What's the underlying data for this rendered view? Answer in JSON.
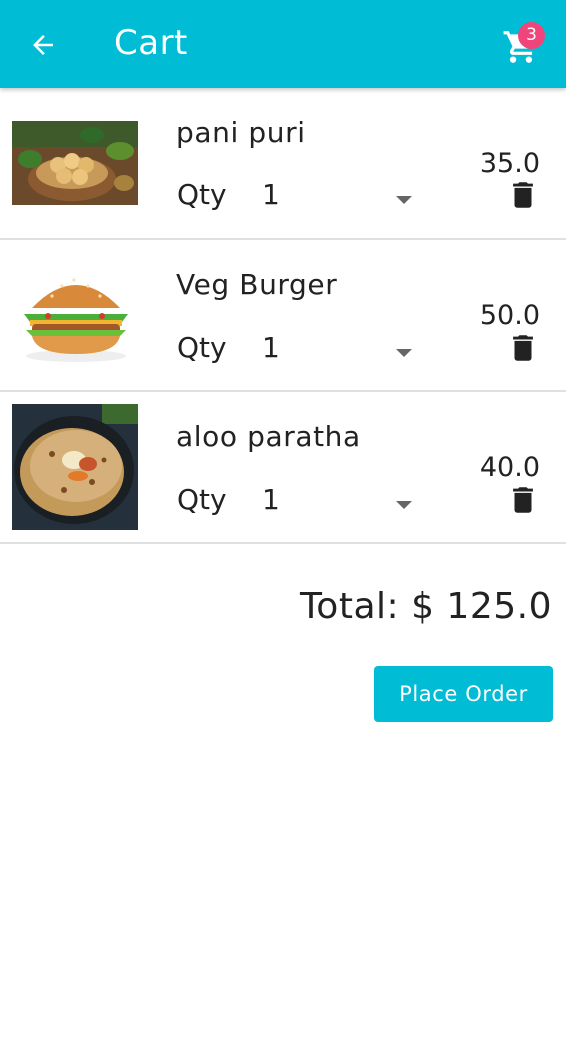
{
  "app_bar": {
    "title": "Cart",
    "back_icon": "arrow-left-icon",
    "cart_icon": "shopping-cart-icon",
    "cart_count": "3",
    "background": "#00BCD4",
    "badge_color": "#F0457A"
  },
  "cart": {
    "items": [
      {
        "name": "pani puri",
        "qty_label": "Qty",
        "qty": "1",
        "price": "35.0",
        "image": "pani-puri-photo",
        "delete_icon": "trash-icon"
      },
      {
        "name": "Veg Burger",
        "qty_label": "Qty",
        "qty": "1",
        "price": "50.0",
        "image": "veg-burger-photo",
        "delete_icon": "trash-icon"
      },
      {
        "name": "aloo paratha",
        "qty_label": "Qty",
        "qty": "1",
        "price": "40.0",
        "image": "aloo-paratha-photo",
        "delete_icon": "trash-icon"
      }
    ]
  },
  "summary": {
    "total_text": "Total: $ 125.0",
    "place_order_label": "Place Order"
  }
}
